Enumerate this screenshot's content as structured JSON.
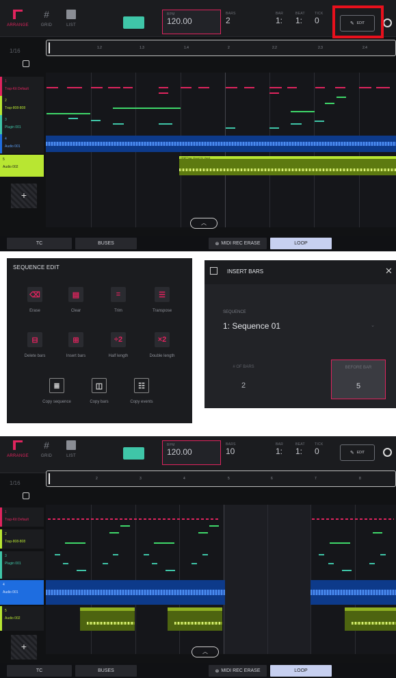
{
  "colors": {
    "accent": "#e0245e",
    "teal": "#3fc6a8",
    "lime": "#b8e632",
    "blue": "#1e6de0",
    "highlight": "#e8101c"
  },
  "screen1": {
    "tabs": [
      {
        "label": "ARRANGE"
      },
      {
        "label": "GRID"
      },
      {
        "label": "LIST"
      }
    ],
    "bpm": {
      "label": "BPM",
      "value": "120.00"
    },
    "bars": {
      "label": "BARS",
      "value": "2"
    },
    "bar": {
      "label": "BAR",
      "value": "1:"
    },
    "beat": {
      "label": "BEAT",
      "value": "1:"
    },
    "tick": {
      "label": "TICK",
      "value": "0"
    },
    "edit_label": "EDIT",
    "quantize": "1/16",
    "ruler_ticks": [
      "1.2",
      "1.3",
      "1.4",
      "2",
      "2.2",
      "2.3",
      "2.4"
    ],
    "tracks": [
      {
        "num": "1",
        "name": "Trap-Kit Default"
      },
      {
        "num": "2",
        "name": "Trap-808-808"
      },
      {
        "num": "3",
        "name": "Plugin 001"
      },
      {
        "num": "4",
        "name": "Audio 001"
      },
      {
        "num": "5",
        "name": "Audio 002"
      }
    ],
    "clip_label": "ONETrap Vocal 01 Vox4",
    "bottom": {
      "tc": "TC",
      "buses": "BUSES",
      "erase": "MIDI REC ERASE",
      "loop": "LOOP"
    }
  },
  "sequence_edit": {
    "title": "SEQUENCE EDIT",
    "items": [
      {
        "label": "Erase",
        "icon": "eraser-icon",
        "glyph": "⌫"
      },
      {
        "label": "Clear",
        "icon": "clear-icon",
        "glyph": "▤"
      },
      {
        "label": "Trim",
        "icon": "trim-icon",
        "glyph": "≡"
      },
      {
        "label": "Transpose",
        "icon": "transpose-icon",
        "glyph": "☰"
      },
      {
        "label": "Delete bars",
        "icon": "delete-bars-icon",
        "glyph": "⊟"
      },
      {
        "label": "Insert bars",
        "icon": "insert-bars-icon",
        "glyph": "⊞"
      },
      {
        "label": "Half length",
        "icon": "half-length-icon",
        "glyph": "÷2"
      },
      {
        "label": "Double length",
        "icon": "double-length-icon",
        "glyph": "×2"
      },
      {
        "label": "Copy sequence",
        "icon": "copy-sequence-icon",
        "glyph": "≣"
      },
      {
        "label": "Copy bars",
        "icon": "copy-bars-icon",
        "glyph": "◫"
      },
      {
        "label": "Copy events",
        "icon": "copy-events-icon",
        "glyph": "☷"
      }
    ]
  },
  "insert_bars": {
    "title": "INSERT BARS",
    "sequence_label": "SEQUENCE",
    "sequence_value": "1: Sequence 01",
    "num_bars_label": "# OF BARS",
    "num_bars_value": "2",
    "before_bar_label": "BEFORE BAR",
    "before_bar_value": "5"
  },
  "screen2": {
    "tabs": [
      {
        "label": "ARRANGE"
      },
      {
        "label": "GRID"
      },
      {
        "label": "LIST"
      }
    ],
    "bpm": {
      "label": "BPM",
      "value": "120.00"
    },
    "bars": {
      "label": "BARS",
      "value": "10"
    },
    "bar": {
      "label": "BAR",
      "value": "1:"
    },
    "beat": {
      "label": "BEAT",
      "value": "1:"
    },
    "tick": {
      "label": "TICK",
      "value": "0"
    },
    "edit_label": "EDIT",
    "quantize": "1/16",
    "ruler_ticks": [
      "2",
      "3",
      "4",
      "5",
      "6",
      "7",
      "8"
    ],
    "tracks": [
      {
        "num": "1",
        "name": "Trap-Kit Default"
      },
      {
        "num": "2",
        "name": "Trap-808-808"
      },
      {
        "num": "3",
        "name": "Plugin 001"
      },
      {
        "num": "4",
        "name": "Audio 001"
      },
      {
        "num": "5",
        "name": "Audio 002"
      }
    ],
    "bottom": {
      "tc": "TC",
      "buses": "BUSES",
      "erase": "MIDI REC ERASE",
      "loop": "LOOP"
    }
  }
}
